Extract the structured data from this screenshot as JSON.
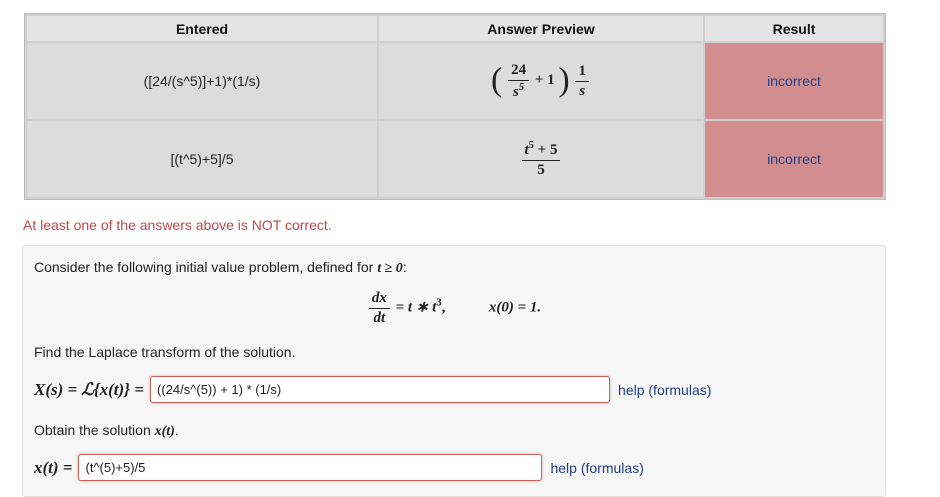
{
  "table": {
    "headers": [
      "Entered",
      "Answer Preview",
      "Result"
    ],
    "rows": [
      {
        "entered": "([24/(s^5)]+1)*(1/s)",
        "result": "incorrect"
      },
      {
        "entered": "[(t^5)+5]/5",
        "result": "incorrect"
      }
    ]
  },
  "preview1": {
    "numerator": "24",
    "denominator_base": "s",
    "denominator_exp": "5",
    "plus_one": "+ 1",
    "one": "1",
    "s": "s"
  },
  "preview2": {
    "numerator_base": "t",
    "numerator_exp": "5",
    "numerator_rest": " + 5",
    "denominator": "5"
  },
  "warning": "At least one of the answers above is NOT correct.",
  "problem": {
    "intro": "Consider the following initial value problem, defined for ",
    "intro_cond": "t ≥ 0",
    "intro_end": ":",
    "ode_num": "dx",
    "ode_den": "dt",
    "ode_rhs": "= t ∗ t",
    "ode_rhs_exp": "3",
    "ode_rhs_end": ",",
    "initial": "x(0) = 1.",
    "part1_prompt": "Find the Laplace transform of the solution.",
    "part1_label": "X(s) = ℒ{x(t)} =",
    "part1_value": "((24/s^(5)) + 1) * (1/s)",
    "part2_prompt_pre": "Obtain the solution ",
    "part2_prompt_var": "x(t)",
    "part2_prompt_end": ".",
    "part2_label": "x(t) =",
    "part2_value": "(t^(5)+5)/5",
    "help_text": "help (formulas)"
  },
  "colors": {
    "incorrect_bg": "#d28e8e",
    "warning": "#b9484a",
    "link": "#1f3e8a"
  }
}
